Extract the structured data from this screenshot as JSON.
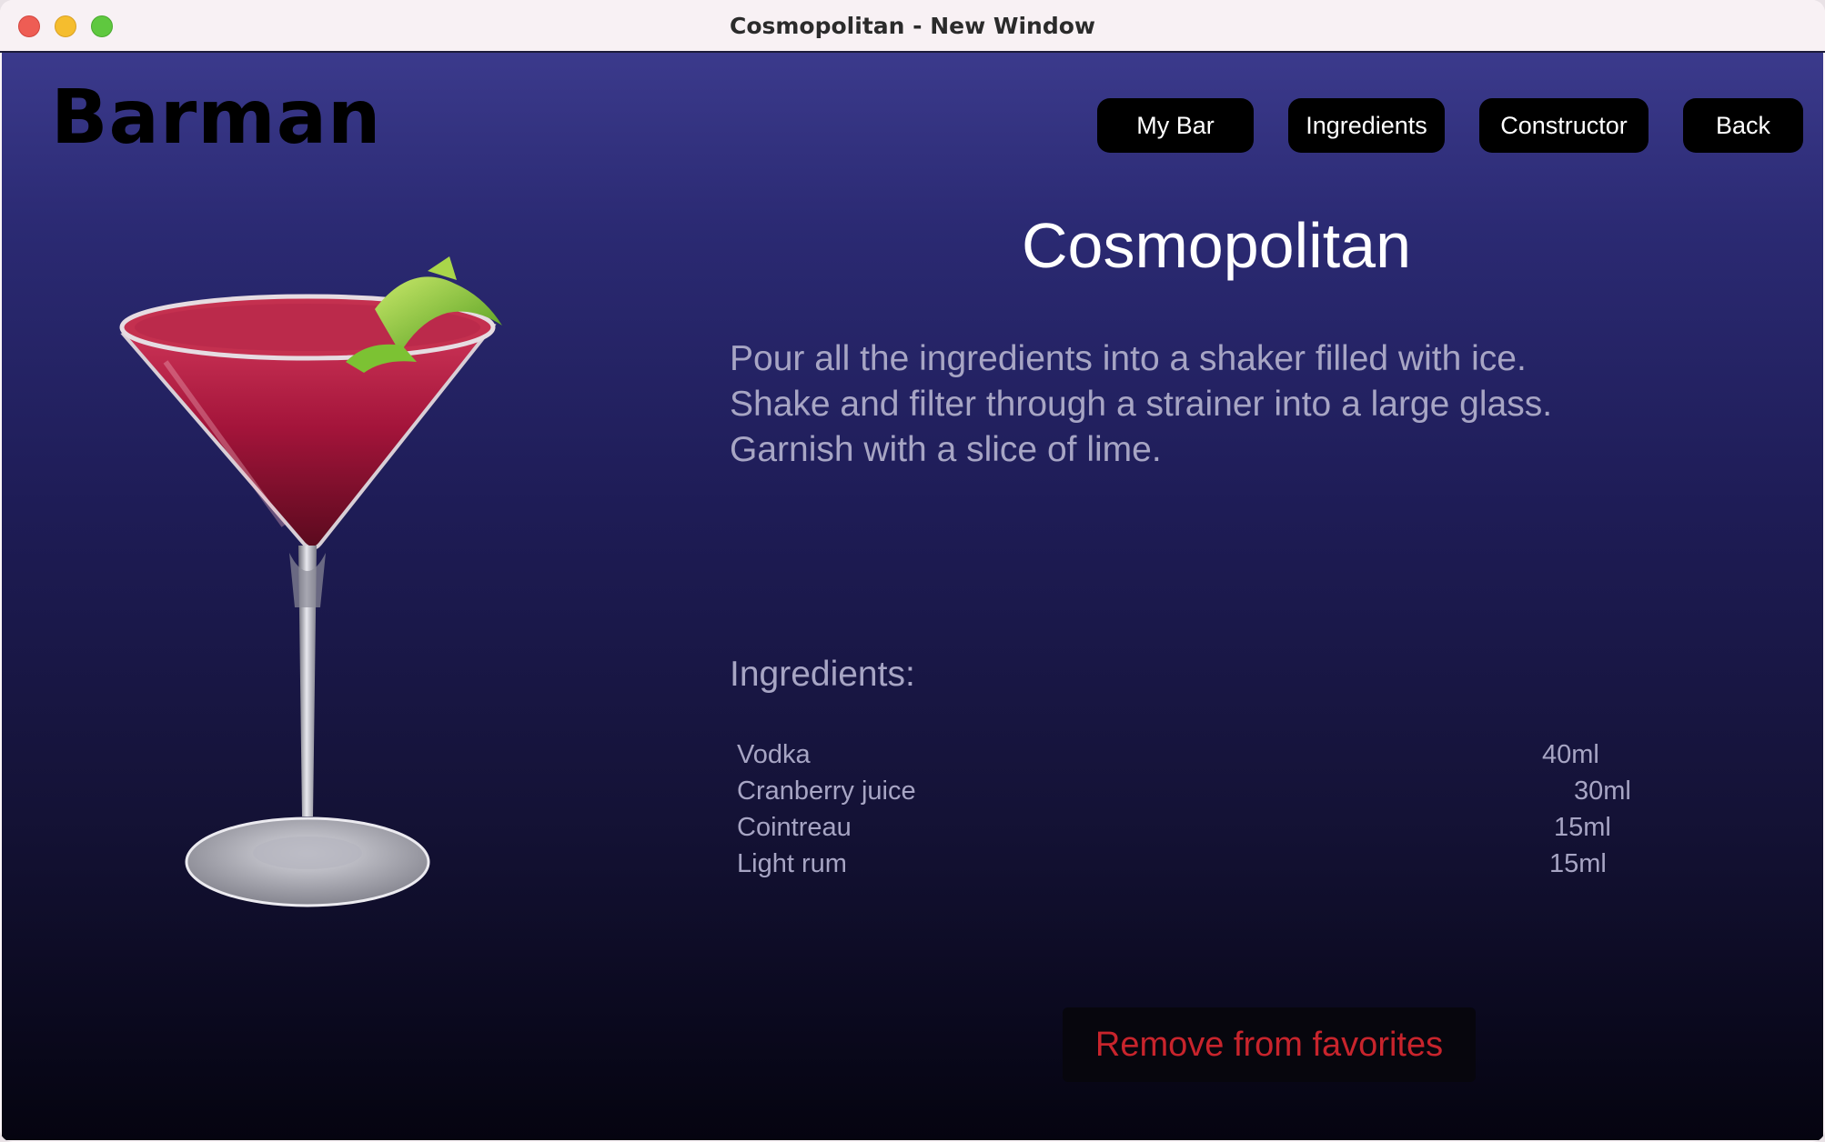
{
  "window": {
    "title": "Cosmopolitan - New Window"
  },
  "app": {
    "logo": "Barman"
  },
  "nav": {
    "my_bar": "My Bar",
    "ingredients": "Ingredients",
    "constructor": "Constructor",
    "back": "Back"
  },
  "drink": {
    "name": "Cosmopolitan",
    "recipe_lines": [
      "Pour all the ingredients into a shaker filled with ice.",
      "Shake and filter through a strainer into a large glass.",
      "Garnish with a slice of lime."
    ],
    "ingredients_heading": "Ingredients:",
    "ingredients": [
      {
        "name": "Vodka",
        "amount": "40ml"
      },
      {
        "name": "Cranberry juice",
        "amount": "30ml"
      },
      {
        "name": "Cointreau",
        "amount": "15ml"
      },
      {
        "name": "Light rum",
        "amount": "15ml"
      }
    ]
  },
  "actions": {
    "remove_favorite": "Remove from favorites"
  },
  "colors": {
    "accent_remove": "#c8242c",
    "nav_button_bg": "#000000",
    "text_muted": "#a7a5c4"
  },
  "icons": {
    "close": "traffic-close-icon",
    "minimize": "traffic-minimize-icon",
    "maximize": "traffic-maximize-icon"
  }
}
